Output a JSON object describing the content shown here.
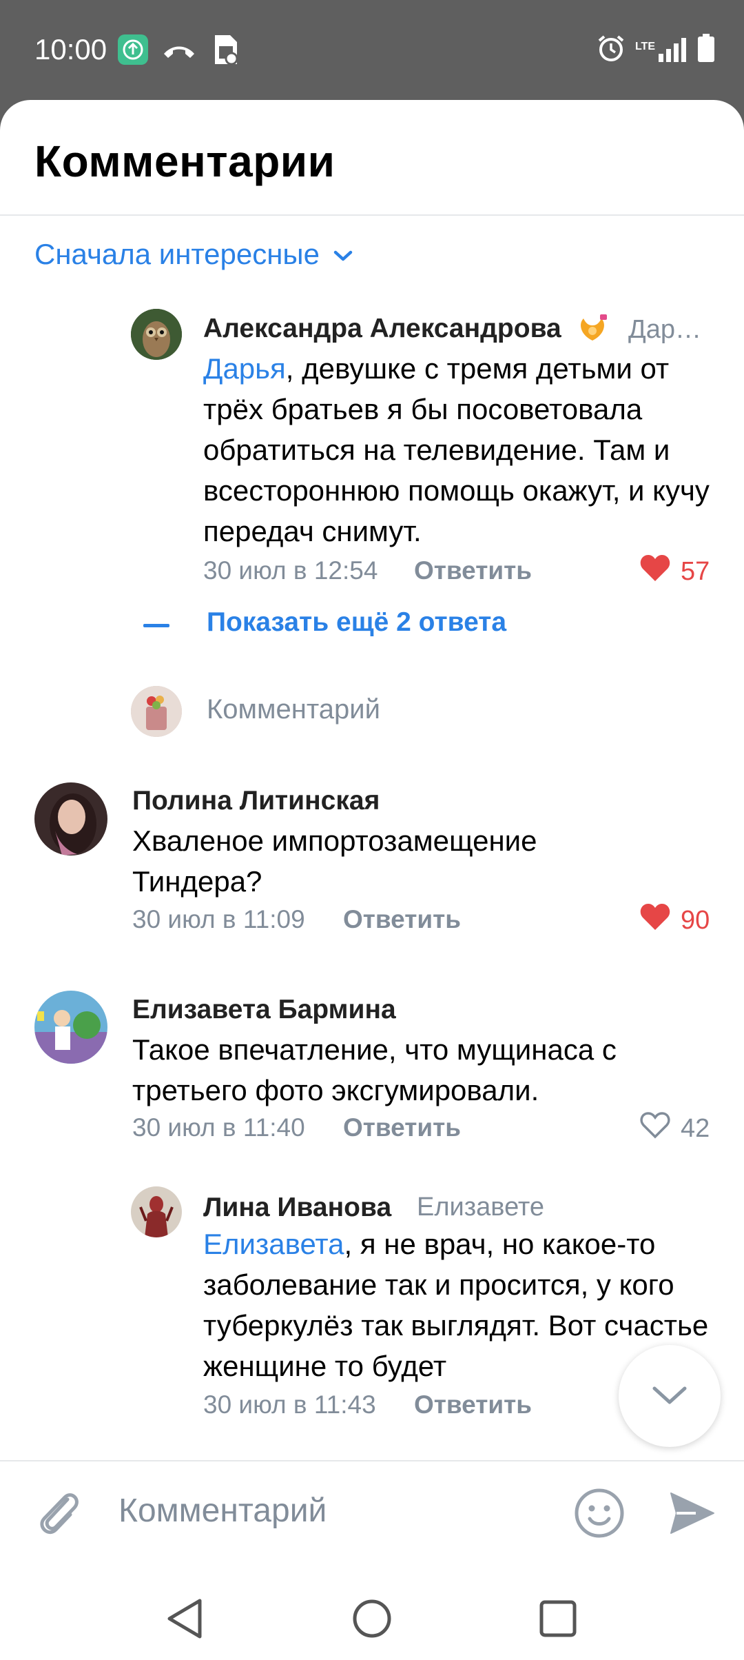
{
  "status_bar": {
    "time": "10:00",
    "icons": [
      "upload-notification-icon",
      "missed-call-icon",
      "sim-settings-icon",
      "alarm-icon",
      "lte-signal-icon",
      "battery-icon"
    ],
    "network_label": "LTE"
  },
  "sheet": {
    "title": "Комментарии",
    "sort_label": "Сначала интересные"
  },
  "comments": [
    {
      "author": "Александра Александрова",
      "reply_to": "Дар…",
      "mention": "Дарья",
      "text": ", девушке с тремя детьми от трёх братьев я бы посоветовала обратиться на телевидение. Там и всестороннюю помощь окажут, и кучу передач снимут.",
      "time": "30 июл в 12:54",
      "reply_label": "Ответить",
      "likes": "57",
      "liked": true
    },
    {
      "author": "Полина Литинская",
      "text": "Хваленое импортозамещение Тиндера?",
      "time": "30 июл в 11:09",
      "reply_label": "Ответить",
      "likes": "90",
      "liked": true
    },
    {
      "author": "Елизавета Бармина",
      "text": "Такое впечатление, что мущинаса с третьего фото эксгумировали.",
      "time": "30 июл в 11:40",
      "reply_label": "Ответить",
      "likes": "42",
      "liked": false
    },
    {
      "author": "Лина Иванова",
      "reply_to": "Елизавете",
      "mention": "Елизавета",
      "text": ", я не врач, но какое-то заболевание так и просится, у кого туберкулёз так выглядят. Вот счастье женщине то будет",
      "time": "30 июл в 11:43",
      "reply_label": "Ответить"
    }
  ],
  "show_more": "Показать ещё 2 ответа",
  "thread_reply_placeholder": "Комментарий",
  "composer": {
    "placeholder": "Комментарий"
  },
  "colors": {
    "accent": "#2a81e6",
    "like_red": "#e64646",
    "secondary_text": "#818c99",
    "status_bar_bg": "#5f5f5f"
  }
}
